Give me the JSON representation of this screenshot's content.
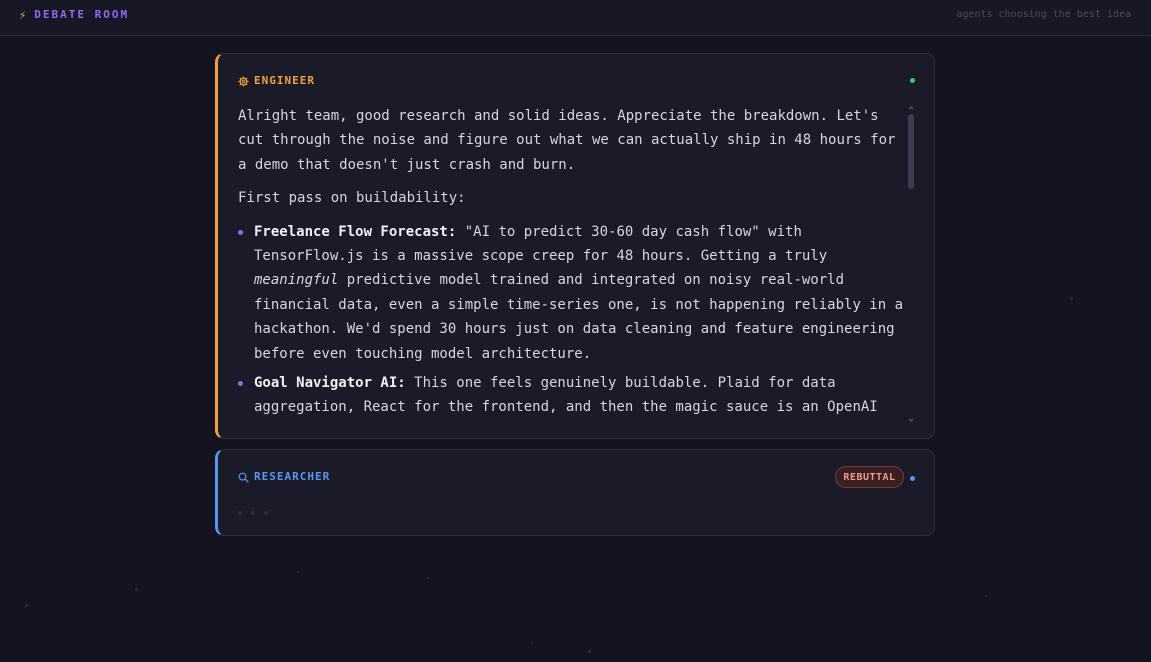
{
  "header": {
    "icon": "lightning-icon",
    "title": "DEBATE ROOM",
    "tagline": "agents choosing the best idea"
  },
  "colors": {
    "engineer": "#f2a03a",
    "researcher": "#5b95f2",
    "accent": "#8a6cf2",
    "status_online": "#3cc97a",
    "rebuttal": "#f29a8a"
  },
  "engineer_card": {
    "icon": "gear-icon",
    "role": "ENGINEER",
    "intro": "Alright team, good research and solid ideas. Appreciate the breakdown. Let's cut through the noise and figure out what we can actually ship in 48 hours for a demo that doesn't just crash and burn.",
    "subhead": "First pass on buildability:",
    "items": [
      {
        "lead": "Freelance Flow Forecast:",
        "text_before": " \"AI to predict 30-60 day cash flow\" with TensorFlow.js is a massive scope creep for 48 hours. Getting a truly ",
        "emphasis": "meaningful",
        "text_after": " predictive model trained and integrated on noisy real-world financial data, even a simple time-series one, is not happening reliably in a hackathon. We'd spend 30 hours just on data cleaning and feature engineering before even touching model architecture."
      },
      {
        "lead": "Goal Navigator AI:",
        "text_before": " This one feels genuinely buildable. Plaid for data aggregation, React for the frontend, and then the magic sauce is an OpenAI API",
        "emphasis": "",
        "text_after": ""
      }
    ]
  },
  "researcher_card": {
    "icon": "search-icon",
    "role": "RESEARCHER",
    "badge": "REBUTTAL"
  }
}
